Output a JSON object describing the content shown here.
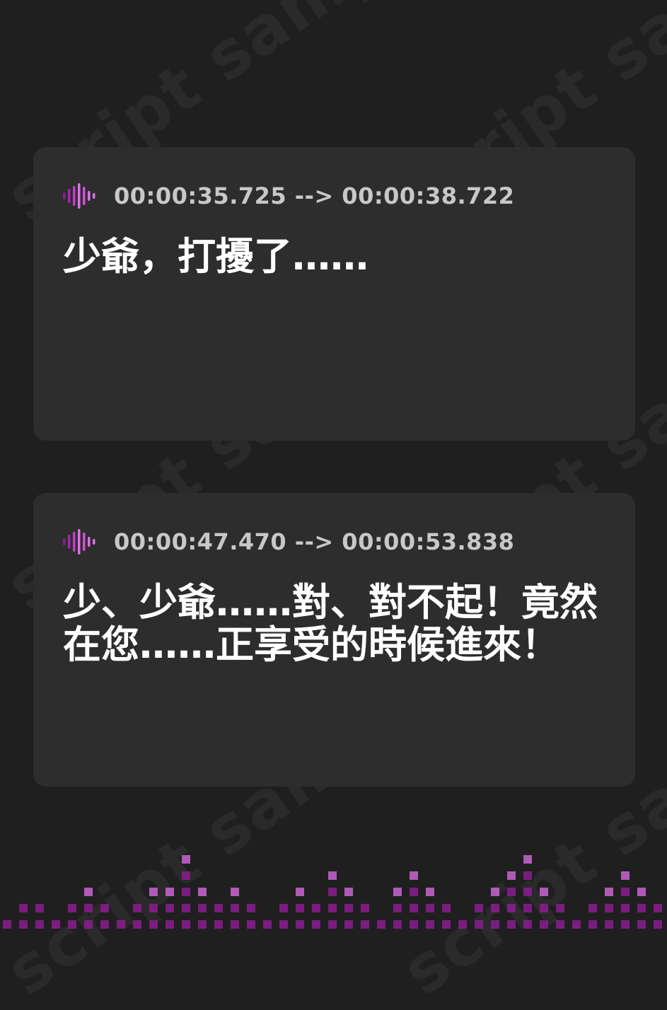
{
  "watermark": {
    "text": "script sample"
  },
  "cards": [
    {
      "timecode": "00:00:35.725 --> 00:00:38.722",
      "text": "少爺，打擾了……"
    },
    {
      "timecode": "00:00:47.470 --> 00:00:53.838",
      "text": "少、少爺……對、對不起！竟然在您……正享受的時候進來！"
    }
  ],
  "colors": {
    "background": "#1f1f20",
    "card": "#2d2d2e",
    "timecode": "#c8c8c8",
    "text": "#ffffff",
    "accent_light": "#e070e8",
    "accent_dark": "#8b1d8f"
  },
  "icons": {
    "card_icon": "audio-waveform-icon",
    "footer": "equalizer-bars-decoration"
  }
}
